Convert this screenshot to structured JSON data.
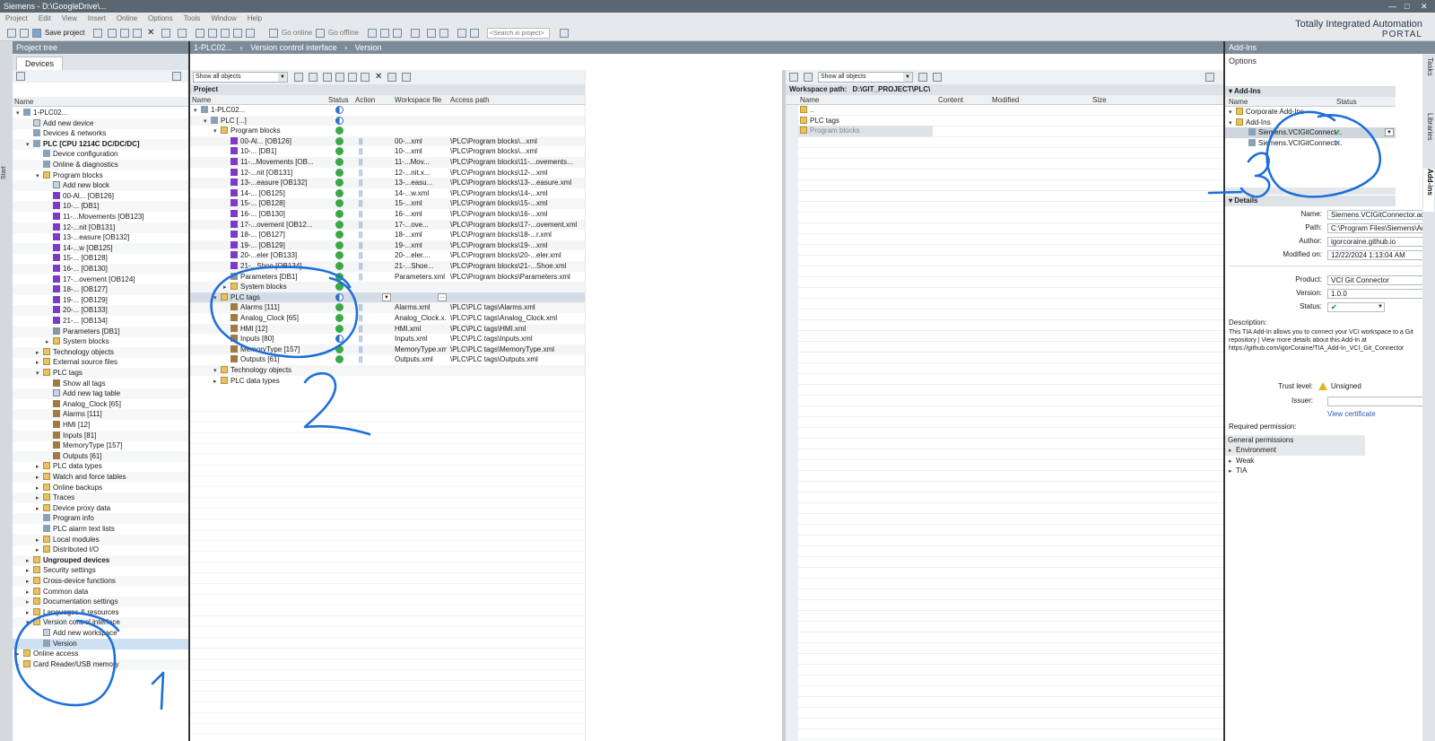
{
  "app": {
    "title": "Siemens  -  D:\\GoogleDrive\\...",
    "brand_line1": "Totally Integrated Automation",
    "brand_line2": "PORTAL"
  },
  "menu": [
    "Project",
    "Edit",
    "View",
    "Insert",
    "Online",
    "Options",
    "Tools",
    "Window",
    "Help"
  ],
  "toolbar": {
    "save_label": "Save project",
    "go_online": "Go online",
    "go_offline": "Go offline",
    "search_placeholder": "<Search in project>"
  },
  "project_tree": {
    "title": "Project tree",
    "tab": "Devices",
    "col_name": "Name",
    "side_tab": "Start",
    "items": [
      {
        "label": "1-PLC02...",
        "level": 0,
        "icon": "gen",
        "exp": "open"
      },
      {
        "label": "Add new device",
        "level": 1,
        "icon": "add",
        "exp": ""
      },
      {
        "label": "Devices & networks",
        "level": 1,
        "icon": "gen",
        "exp": ""
      },
      {
        "label": "PLC [CPU 1214C DC/DC/DC]",
        "level": 1,
        "icon": "gen",
        "exp": "open",
        "bold": true
      },
      {
        "label": "Device configuration",
        "level": 2,
        "icon": "gen",
        "exp": ""
      },
      {
        "label": "Online & diagnostics",
        "level": 2,
        "icon": "gen",
        "exp": ""
      },
      {
        "label": "Program blocks",
        "level": 2,
        "icon": "fold",
        "exp": "open"
      },
      {
        "label": "Add new block",
        "level": 3,
        "icon": "add",
        "exp": ""
      },
      {
        "label": "00-Al... [OB126]",
        "level": 3,
        "icon": "ob",
        "exp": ""
      },
      {
        "label": "10-... [DB1]",
        "level": 3,
        "icon": "ob",
        "exp": ""
      },
      {
        "label": "11-...Movements [OB123]",
        "level": 3,
        "icon": "ob",
        "exp": ""
      },
      {
        "label": "12-...nit [OB131]",
        "level": 3,
        "icon": "ob",
        "exp": ""
      },
      {
        "label": "13-...easure [OB132]",
        "level": 3,
        "icon": "ob",
        "exp": ""
      },
      {
        "label": "14-...w [OB125]",
        "level": 3,
        "icon": "ob",
        "exp": ""
      },
      {
        "label": "15-... [OB128]",
        "level": 3,
        "icon": "ob",
        "exp": ""
      },
      {
        "label": "16-... [OB130]",
        "level": 3,
        "icon": "ob",
        "exp": ""
      },
      {
        "label": "17-...ovement [OB124]",
        "level": 3,
        "icon": "ob",
        "exp": ""
      },
      {
        "label": "18-... [OB127]",
        "level": 3,
        "icon": "ob",
        "exp": ""
      },
      {
        "label": "19-... [OB129]",
        "level": 3,
        "icon": "ob",
        "exp": ""
      },
      {
        "label": "20-... [OB133]",
        "level": 3,
        "icon": "ob",
        "exp": ""
      },
      {
        "label": "21-... [OB134]",
        "level": 3,
        "icon": "ob",
        "exp": ""
      },
      {
        "label": "Parameters [DB1]",
        "level": 3,
        "icon": "db",
        "exp": ""
      },
      {
        "label": "System blocks",
        "level": 3,
        "icon": "fold",
        "exp": "closed"
      },
      {
        "label": "Technology objects",
        "level": 2,
        "icon": "fold",
        "exp": "closed"
      },
      {
        "label": "External source files",
        "level": 2,
        "icon": "fold",
        "exp": "closed"
      },
      {
        "label": "PLC tags",
        "level": 2,
        "icon": "fold",
        "exp": "open"
      },
      {
        "label": "Show all tags",
        "level": 3,
        "icon": "tag",
        "exp": ""
      },
      {
        "label": "Add new tag table",
        "level": 3,
        "icon": "add",
        "exp": ""
      },
      {
        "label": "Analog_Clock [65]",
        "level": 3,
        "icon": "tag",
        "exp": ""
      },
      {
        "label": "Alarms [111]",
        "level": 3,
        "icon": "tag",
        "exp": ""
      },
      {
        "label": "HMI [12]",
        "level": 3,
        "icon": "tag",
        "exp": ""
      },
      {
        "label": "Inputs [81]",
        "level": 3,
        "icon": "tag",
        "exp": ""
      },
      {
        "label": "MemoryType [157]",
        "level": 3,
        "icon": "tag",
        "exp": ""
      },
      {
        "label": "Outputs [61]",
        "level": 3,
        "icon": "tag",
        "exp": ""
      },
      {
        "label": "PLC data types",
        "level": 2,
        "icon": "fold",
        "exp": "closed"
      },
      {
        "label": "Watch and force tables",
        "level": 2,
        "icon": "fold",
        "exp": "closed"
      },
      {
        "label": "Online backups",
        "level": 2,
        "icon": "fold",
        "exp": "closed"
      },
      {
        "label": "Traces",
        "level": 2,
        "icon": "fold",
        "exp": "closed"
      },
      {
        "label": "Device proxy data",
        "level": 2,
        "icon": "fold",
        "exp": "closed"
      },
      {
        "label": "Program info",
        "level": 2,
        "icon": "gen",
        "exp": ""
      },
      {
        "label": "PLC alarm text lists",
        "level": 2,
        "icon": "gen",
        "exp": ""
      },
      {
        "label": "Local modules",
        "level": 2,
        "icon": "fold",
        "exp": "closed"
      },
      {
        "label": "Distributed I/O",
        "level": 2,
        "icon": "fold",
        "exp": "closed"
      },
      {
        "label": "Ungrouped devices",
        "level": 1,
        "icon": "fold",
        "exp": "closed",
        "bold": true
      },
      {
        "label": "Security settings",
        "level": 1,
        "icon": "fold",
        "exp": "closed"
      },
      {
        "label": "Cross-device functions",
        "level": 1,
        "icon": "fold",
        "exp": "closed"
      },
      {
        "label": "Common data",
        "level": 1,
        "icon": "fold",
        "exp": "closed"
      },
      {
        "label": "Documentation settings",
        "level": 1,
        "icon": "fold",
        "exp": "closed"
      },
      {
        "label": "Languages & resources",
        "level": 1,
        "icon": "fold",
        "exp": "closed"
      },
      {
        "label": "Version control interface",
        "level": 1,
        "icon": "fold",
        "exp": "open"
      },
      {
        "label": "Add new workspace",
        "level": 2,
        "icon": "add",
        "exp": ""
      },
      {
        "label": "Version",
        "level": 2,
        "icon": "gen",
        "exp": "",
        "selected": true
      },
      {
        "label": "Online access",
        "level": 0,
        "icon": "fold",
        "exp": "closed"
      },
      {
        "label": "Card Reader/USB memory",
        "level": 0,
        "icon": "fold",
        "exp": "closed"
      }
    ]
  },
  "editor": {
    "breadcrumb": [
      "1-PLC02...",
      "Version control interface",
      "Version"
    ],
    "filter": "Show all objects",
    "section": "Project",
    "cols": {
      "name": "Name",
      "status": "Status",
      "action": "Action",
      "file": "Workspace file",
      "path": "Access path"
    },
    "rows": [
      {
        "name": "1-PLC02...",
        "lvl": 0,
        "icon": "gen",
        "exp": "open",
        "status": "half",
        "action": false,
        "file": "",
        "path": ""
      },
      {
        "name": "PLC [...]",
        "lvl": 1,
        "icon": "gen",
        "exp": "open",
        "status": "half",
        "action": false,
        "file": "",
        "path": ""
      },
      {
        "name": "Program blocks",
        "lvl": 2,
        "icon": "fold",
        "exp": "open",
        "status": "ok",
        "action": false,
        "file": "",
        "path": ""
      },
      {
        "name": "00-Al... [OB126]",
        "lvl": 3,
        "icon": "ob",
        "exp": "",
        "status": "ok",
        "action": true,
        "file": "00-...xml",
        "path": "\\PLC\\Program blocks\\...xml"
      },
      {
        "name": "10-... [DB1]",
        "lvl": 3,
        "icon": "ob",
        "exp": "",
        "status": "ok",
        "action": true,
        "file": "10-...xml",
        "path": "\\PLC\\Program blocks\\...xml"
      },
      {
        "name": "11-...Movements [OB...",
        "lvl": 3,
        "icon": "ob",
        "exp": "",
        "status": "ok",
        "action": true,
        "file": "11-...Mov...",
        "path": "\\PLC\\Program blocks\\11-...ovements..."
      },
      {
        "name": "12-...nit [OB131]",
        "lvl": 3,
        "icon": "ob",
        "exp": "",
        "status": "ok",
        "action": true,
        "file": "12-...nit.x...",
        "path": "\\PLC\\Program blocks\\12-...xml"
      },
      {
        "name": "13-...easure [OB132]",
        "lvl": 3,
        "icon": "ob",
        "exp": "",
        "status": "ok",
        "action": true,
        "file": "13-...easu...",
        "path": "\\PLC\\Program blocks\\13-...easure.xml"
      },
      {
        "name": "14-... [OB125]",
        "lvl": 3,
        "icon": "ob",
        "exp": "",
        "status": "ok",
        "action": true,
        "file": "14-...w.xml",
        "path": "\\PLC\\Program blocks\\14-...xml"
      },
      {
        "name": "15-... [OB128]",
        "lvl": 3,
        "icon": "ob",
        "exp": "",
        "status": "ok",
        "action": true,
        "file": "15-...xml",
        "path": "\\PLC\\Program blocks\\15-...xml"
      },
      {
        "name": "16-... [OB130]",
        "lvl": 3,
        "icon": "ob",
        "exp": "",
        "status": "ok",
        "action": true,
        "file": "16-...xml",
        "path": "\\PLC\\Program blocks\\16-...xml"
      },
      {
        "name": "17-...ovement [OB12...",
        "lvl": 3,
        "icon": "ob",
        "exp": "",
        "status": "ok",
        "action": true,
        "file": "17-...ove...",
        "path": "\\PLC\\Program blocks\\17-...ovement.xml"
      },
      {
        "name": "18-... [OB127]",
        "lvl": 3,
        "icon": "ob",
        "exp": "",
        "status": "ok",
        "action": true,
        "file": "18-...xml",
        "path": "\\PLC\\Program blocks\\18-...r.xml"
      },
      {
        "name": "19-... [OB129]",
        "lvl": 3,
        "icon": "ob",
        "exp": "",
        "status": "ok",
        "action": true,
        "file": "19-...xml",
        "path": "\\PLC\\Program blocks\\19-...xml"
      },
      {
        "name": "20-...eler [OB133]",
        "lvl": 3,
        "icon": "ob",
        "exp": "",
        "status": "ok",
        "action": true,
        "file": "20-...eler....",
        "path": "\\PLC\\Program blocks\\20-...eler.xml"
      },
      {
        "name": "21-...Shoe [OB134]",
        "lvl": 3,
        "icon": "ob",
        "exp": "",
        "status": "ok",
        "action": true,
        "file": "21-...Shoe...",
        "path": "\\PLC\\Program blocks\\21-...Shoe.xml"
      },
      {
        "name": "Parameters [DB1]",
        "lvl": 3,
        "icon": "db",
        "exp": "",
        "status": "ok",
        "action": true,
        "file": "Parameters.xml",
        "path": "\\PLC\\Program blocks\\Parameters.xml"
      },
      {
        "name": "System blocks",
        "lvl": 3,
        "icon": "fold",
        "exp": "closed",
        "status": "ok",
        "action": false,
        "file": "",
        "path": ""
      },
      {
        "name": "PLC tags",
        "lvl": 2,
        "icon": "fold",
        "exp": "open",
        "status": "half",
        "action": false,
        "file": "",
        "path": "",
        "selected": true
      },
      {
        "name": "Alarms [111]",
        "lvl": 3,
        "icon": "tag",
        "exp": "",
        "status": "ok",
        "action": true,
        "file": "Alarms.xml",
        "path": "\\PLC\\PLC tags\\Alarms.xml"
      },
      {
        "name": "Analog_Clock [65]",
        "lvl": 3,
        "icon": "tag",
        "exp": "",
        "status": "ok",
        "action": true,
        "file": "Analog_Clock.x...",
        "path": "\\PLC\\PLC tags\\Analog_Clock.xml"
      },
      {
        "name": "HMI [12]",
        "lvl": 3,
        "icon": "tag",
        "exp": "",
        "status": "ok",
        "action": true,
        "file": "HMI.xml",
        "path": "\\PLC\\PLC tags\\HMI.xml"
      },
      {
        "name": "Inputs [80]",
        "lvl": 3,
        "icon": "tag",
        "exp": "",
        "status": "half",
        "action": true,
        "file": "Inputs.xml",
        "path": "\\PLC\\PLC tags\\Inputs.xml"
      },
      {
        "name": "MemoryType [157]",
        "lvl": 3,
        "icon": "tag",
        "exp": "",
        "status": "ok",
        "action": true,
        "file": "MemoryType.xml",
        "path": "\\PLC\\PLC tags\\MemoryType.xml"
      },
      {
        "name": "Outputs [61]",
        "lvl": 3,
        "icon": "tag",
        "exp": "",
        "status": "ok",
        "action": true,
        "file": "Outputs.xml",
        "path": "\\PLC\\PLC tags\\Outputs.xml"
      },
      {
        "name": "Technology objects",
        "lvl": 2,
        "icon": "fold",
        "exp": "open",
        "status": "",
        "action": false,
        "file": "",
        "path": ""
      },
      {
        "name": "PLC data types",
        "lvl": 2,
        "icon": "fold",
        "exp": "closed",
        "status": "",
        "action": false,
        "file": "",
        "path": ""
      }
    ]
  },
  "workspace": {
    "filter": "Show all objects",
    "path_label": "Workspace path:",
    "path_value": "D:\\GIT_PROJECT\\PLC\\",
    "cols": {
      "name": "Name",
      "content": "Content",
      "modified": "Modified",
      "size": "Size"
    },
    "rows": [
      {
        "name": "..",
        "selected": false
      },
      {
        "name": "PLC tags",
        "selected": false
      },
      {
        "name": "Program blocks",
        "selected": true
      }
    ]
  },
  "addins": {
    "title": "Add-Ins",
    "options": "Options",
    "section": "Add-Ins",
    "cols": {
      "name": "Name",
      "status": "Status"
    },
    "tree": [
      {
        "label": "Corporate Add-Ins",
        "level": 0,
        "status": ""
      },
      {
        "label": "Add-Ins",
        "level": 0,
        "status": ""
      },
      {
        "label": "Siemens.VCIGitConnect...",
        "level": 1,
        "status": "ok",
        "selected": true
      },
      {
        "label": "Siemens.VCIGitConnect...",
        "level": 1,
        "status": "x"
      }
    ],
    "details_title": "Details",
    "details": {
      "name_label": "Name:",
      "name": "Siemens.VCIGitConnector.addin",
      "path_label": "Path:",
      "path": "C:\\Program Files\\Siemens\\Automation",
      "author_label": "Author:",
      "author": "igorcoraine.github.io",
      "modified_label": "Modified on:",
      "modified": "12/22/2024 1:13:04 AM",
      "product_label": "Product:",
      "product": "VCI Git Connector",
      "version_label": "Version:",
      "version": "1.0.0",
      "status_label": "Status:"
    },
    "description_label": "Description:",
    "description": "This TIA Add-In allows you to connect your VCI workspace to a Git repository | View more details about this Add-In at https://github.com/igorCoraine/TIA_Add-In_VCI_Git_Connector",
    "trust_label": "Trust level:",
    "trust_value": "Unsigned",
    "issuer_label": "Issuer:",
    "view_cert": "View certificate",
    "required_perm": "Required permission:",
    "general_perm": "General permissions",
    "perm_items": [
      "Environment",
      "Weak",
      "TIA"
    ]
  },
  "side_tabs": [
    "Tasks",
    "Libraries",
    "Add-ins"
  ],
  "annotations": [
    "1",
    "2",
    "3"
  ]
}
